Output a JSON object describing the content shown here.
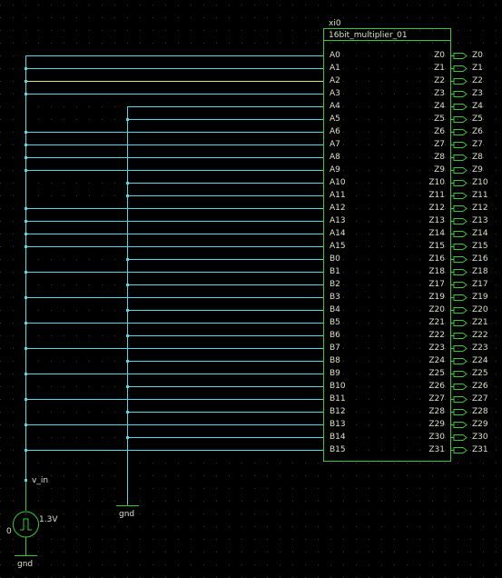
{
  "instance": {
    "ref": "xi0",
    "name": "16bit_multiplier_01"
  },
  "inputs": [
    "A0",
    "A1",
    "A2",
    "A3",
    "A4",
    "A5",
    "A6",
    "A7",
    "A8",
    "A9",
    "A10",
    "A11",
    "A12",
    "A13",
    "A14",
    "A15",
    "B0",
    "B1",
    "B2",
    "B3",
    "B4",
    "B5",
    "B6",
    "B7",
    "B8",
    "B9",
    "B10",
    "B11",
    "B12",
    "B13",
    "B14",
    "B15"
  ],
  "outputs": [
    "Z0",
    "Z1",
    "Z2",
    "Z3",
    "Z4",
    "Z5",
    "Z6",
    "Z7",
    "Z8",
    "Z9",
    "Z10",
    "Z11",
    "Z12",
    "Z13",
    "Z14",
    "Z15",
    "Z16",
    "Z18",
    "Z17",
    "Z19",
    "Z20",
    "Z21",
    "Z22",
    "Z23",
    "Z24",
    "Z25",
    "Z26",
    "Z27",
    "Z28",
    "Z29",
    "Z30",
    "Z31"
  ],
  "output_nets": [
    "Z0",
    "Z1",
    "Z2",
    "Z3",
    "Z4",
    "Z5",
    "Z6",
    "Z7",
    "Z8",
    "Z9",
    "Z10",
    "Z11",
    "Z12",
    "Z13",
    "Z14",
    "Z15",
    "Z16",
    "Z18",
    "Z17",
    "Z19",
    "Z20",
    "Z21",
    "Z22",
    "Z23",
    "Z24",
    "Z25",
    "Z26",
    "Z27",
    "Z28",
    "Z29",
    "Z30",
    "Z31"
  ],
  "input_sources": [
    "vin",
    "vin",
    "vin",
    "vin",
    "gnd",
    "gnd",
    "vin",
    "vin",
    "vin",
    "vin",
    "gnd",
    "gnd",
    "vin",
    "vin",
    "vin",
    "vin",
    "gnd",
    "vin",
    "gnd",
    "vin",
    "gnd",
    "vin",
    "gnd",
    "vin",
    "gnd",
    "vin",
    "gnd",
    "vin",
    "gnd",
    "vin",
    "gnd",
    "vin"
  ],
  "highlighted_input": "A2",
  "net_label": "v_in",
  "source": {
    "value": "1.3V",
    "ref": "0",
    "symbol": "pulse-source-icon"
  },
  "ground_labels": {
    "bus": "gnd",
    "source": "gnd"
  },
  "colors": {
    "wire": "#4fd8e6",
    "highlight": "#e8e060",
    "block": "#38c838",
    "text": "#d8e0c8",
    "grid": "#2a2a2a",
    "bg": "#000000"
  }
}
